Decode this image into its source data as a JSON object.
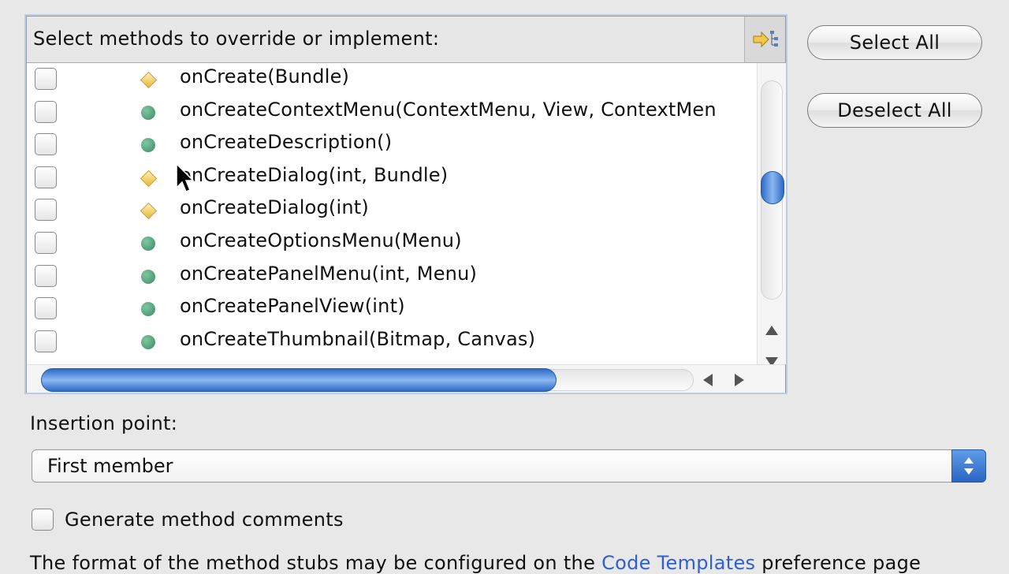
{
  "panel": {
    "title": "Select methods to override or implement:",
    "methods": [
      {
        "name": "onCreate(Bundle)",
        "visibility": "protected",
        "checked": false
      },
      {
        "name": "onCreateContextMenu(ContextMenu, View, ContextMen",
        "visibility": "public",
        "checked": false
      },
      {
        "name": "onCreateDescription()",
        "visibility": "public",
        "checked": false
      },
      {
        "name": "onCreateDialog(int, Bundle)",
        "visibility": "protected",
        "checked": false
      },
      {
        "name": "onCreateDialog(int)",
        "visibility": "protected",
        "checked": false
      },
      {
        "name": "onCreateOptionsMenu(Menu)",
        "visibility": "public",
        "checked": false
      },
      {
        "name": "onCreatePanelMenu(int, Menu)",
        "visibility": "public",
        "checked": false
      },
      {
        "name": "onCreatePanelView(int)",
        "visibility": "public",
        "checked": false
      },
      {
        "name": "onCreateThumbnail(Bitmap, Canvas)",
        "visibility": "public",
        "checked": false
      }
    ]
  },
  "buttons": {
    "select_all": "Select All",
    "deselect_all": "Deselect All"
  },
  "insertion": {
    "label": "Insertion point:",
    "selected": "First member"
  },
  "generate_comments": {
    "label": "Generate method comments",
    "checked": false
  },
  "footer": {
    "text_before": "The format of the method stubs may be configured on the ",
    "link": "Code Templates",
    "text_after": " preference page"
  },
  "icons": {
    "expand": "expand-tree-icon",
    "public_method": "public-method-icon",
    "protected_method": "protected-method-icon",
    "cursor": "mouse-pointer-icon"
  },
  "colors": {
    "public_method": "#3c8a66",
    "protected_method": "#e8b83a",
    "accent": "#2f69c8",
    "link": "#2f5fd0"
  }
}
